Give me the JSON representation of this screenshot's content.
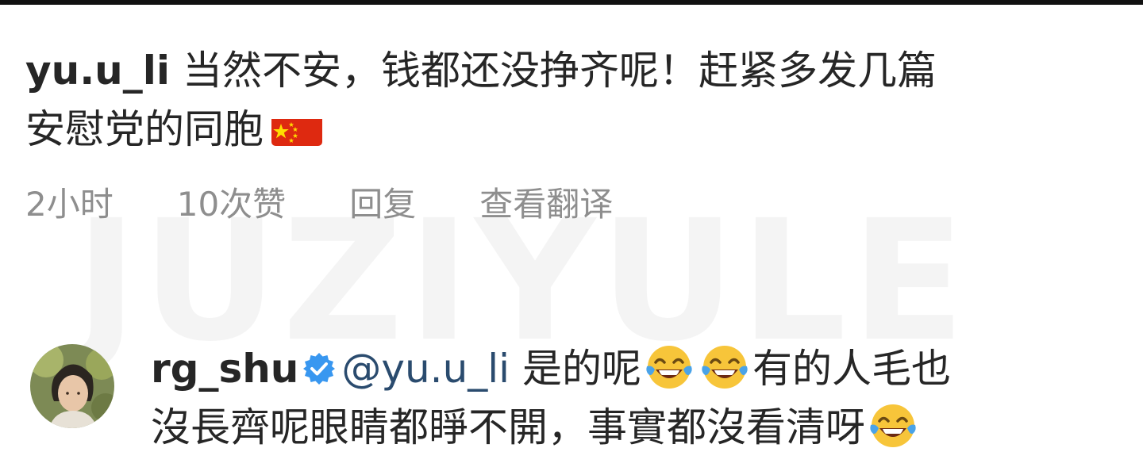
{
  "watermark": "JUZIYULE",
  "comment1": {
    "username": "yu.u_li",
    "text_line1": " 当然不安，钱都还没挣齐呢！赶紧多发几篇",
    "text_line2": "安慰党的同胞",
    "flag_icon": "china-flag-icon"
  },
  "meta": {
    "time": "2小时",
    "likes": "10次赞",
    "reply": "回复",
    "translate": "查看翻译"
  },
  "comment2": {
    "username": "rg_shu",
    "verified_icon": "verified-badge-icon",
    "mention": "@yu.u_li",
    "text_part1": " 是的呢",
    "emoji_icon": "face-with-tears-of-joy-icon",
    "text_part2": "有的人毛也",
    "text_line2": "沒長齊呢眼睛都睜不開，事實都沒看清呀"
  },
  "colors": {
    "text": "#262626",
    "meta": "#8e8e8e",
    "mention": "#2a4b6e",
    "verified": "#3897f0"
  }
}
